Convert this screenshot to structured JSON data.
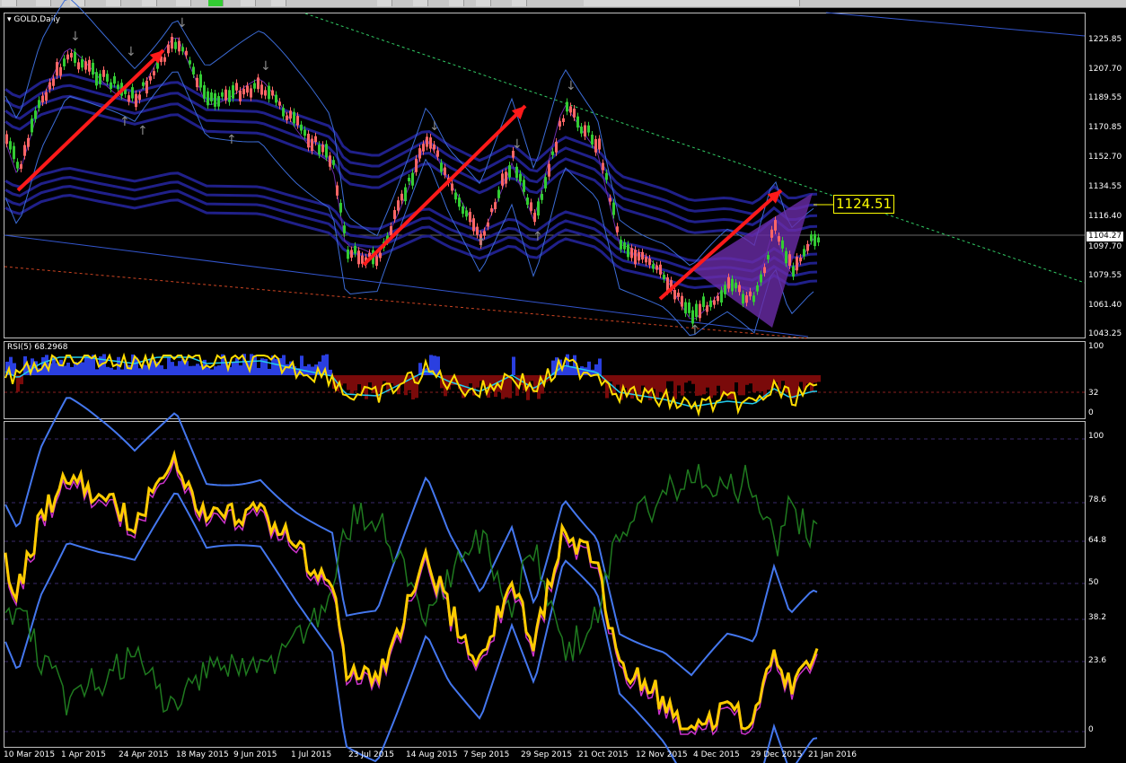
{
  "toolbar": {
    "buttons": [
      "new-chart",
      "templates",
      "profiles",
      "market-watch",
      "navigator",
      "terminal",
      "strategy-tester",
      "new-order",
      "autotrading",
      "bar-chart",
      "candles",
      "line-chart",
      "zoom-in",
      "zoom-out",
      "periods"
    ]
  },
  "chart": {
    "symbol_title": "GOLD,Daily",
    "annotation_price": "1124.51",
    "current_price": "1104.27"
  },
  "price_scale": [
    "1225.85",
    "1207.70",
    "1189.55",
    "1170.85",
    "1152.70",
    "1134.55",
    "1116.40",
    "1097.70",
    "1079.55",
    "1061.40",
    "1043.25"
  ],
  "rsi_pane": {
    "label": "RSI(5) 68.2968",
    "scale": [
      "100",
      "32",
      "0"
    ]
  },
  "osc_scale": [
    "100",
    "78.6",
    "64.8",
    "50",
    "38.2",
    "23.6",
    "0"
  ],
  "date_axis": [
    "10 Mar 2015",
    "1 Apr 2015",
    "24 Apr 2015",
    "18 May 2015",
    "9 Jun 2015",
    "1 Jul 2015",
    "23 Jul 2015",
    "14 Aug 2015",
    "7 Sep 2015",
    "29 Sep 2015",
    "21 Oct 2015",
    "12 Nov 2015",
    "4 Dec 2015",
    "29 Dec 2015",
    "21 Jan 2016"
  ],
  "colors": {
    "up": "#33cc33",
    "down": "#ff6666",
    "rsi": "#ffdd00",
    "arrow": "#ff1a1a",
    "band": "#22227a",
    "accent": "#6a2ca8"
  }
}
